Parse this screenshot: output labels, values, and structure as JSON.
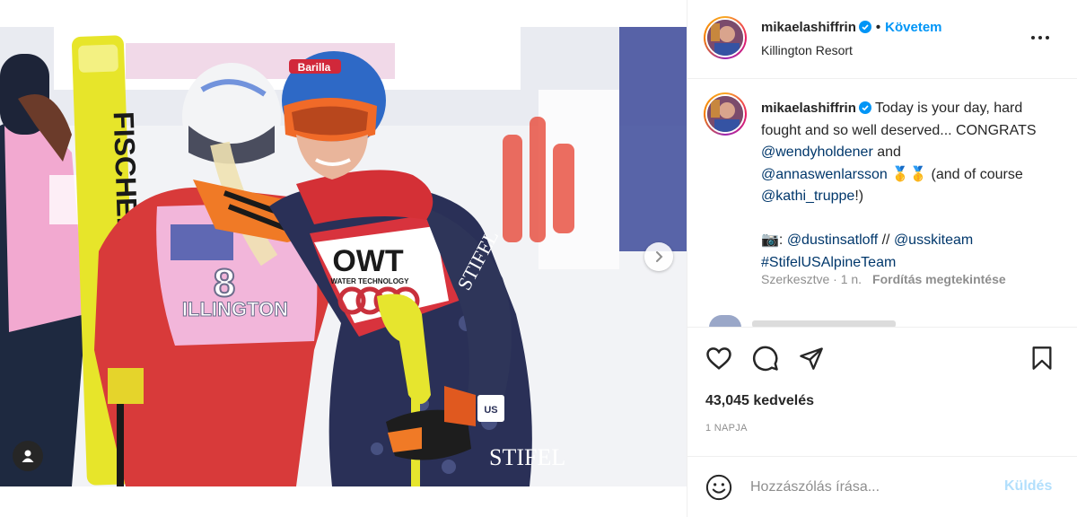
{
  "post": {
    "username": "mikaelashiffrin",
    "follow_label": "Követem",
    "location": "Killington Resort",
    "caption": {
      "username": "mikaelashiffrin",
      "text_1": "Today is your day, hard fought and so well deserved... CONGRATS ",
      "mention_1": "@wendyholdener",
      "text_2": " and ",
      "mention_2": "@annaswenlarsson",
      "text_3": " 🥇🥇 (and of course ",
      "mention_3": "@kathi_truppe",
      "text_4": "!)",
      "camera": "📷",
      "text_5": ": ",
      "mention_4": "@dustinsatloff",
      "text_6": " // ",
      "mention_5": "@usskiteam",
      "hashtag": "#StifelUSAlpineTeam",
      "edited": "Szerkesztve · 1 n.",
      "translate_label": "Fordítás megtekintése"
    },
    "likes": "43,045 kedvelés",
    "date": "1 NAPJA",
    "comment_placeholder": "Hozzászólás írása...",
    "send_label": "Küldés"
  },
  "photo": {
    "bib_number": "8",
    "bib_text": "ILLINGTON",
    "sponsor_1": "OWT",
    "sponsor_1_sub": "WATER TECHNOLOGY",
    "ski_brand": "FISCHER",
    "helmet_brand": "Barilla",
    "suit_brand": "STIFEL",
    "team_label": "US"
  },
  "icons": {
    "verified": "verified-badge-icon",
    "more": "more-options-icon",
    "like": "heart-icon",
    "comment": "comment-bubble-icon",
    "share": "paper-plane-icon",
    "save": "bookmark-icon",
    "emoji": "emoji-smile-icon",
    "next": "chevron-right-icon",
    "tagged": "user-tag-icon"
  },
  "colors": {
    "accent": "#0095f6",
    "send_disabled": "#b2dffc",
    "mention": "#00376b",
    "muted": "#8e8e8e"
  }
}
